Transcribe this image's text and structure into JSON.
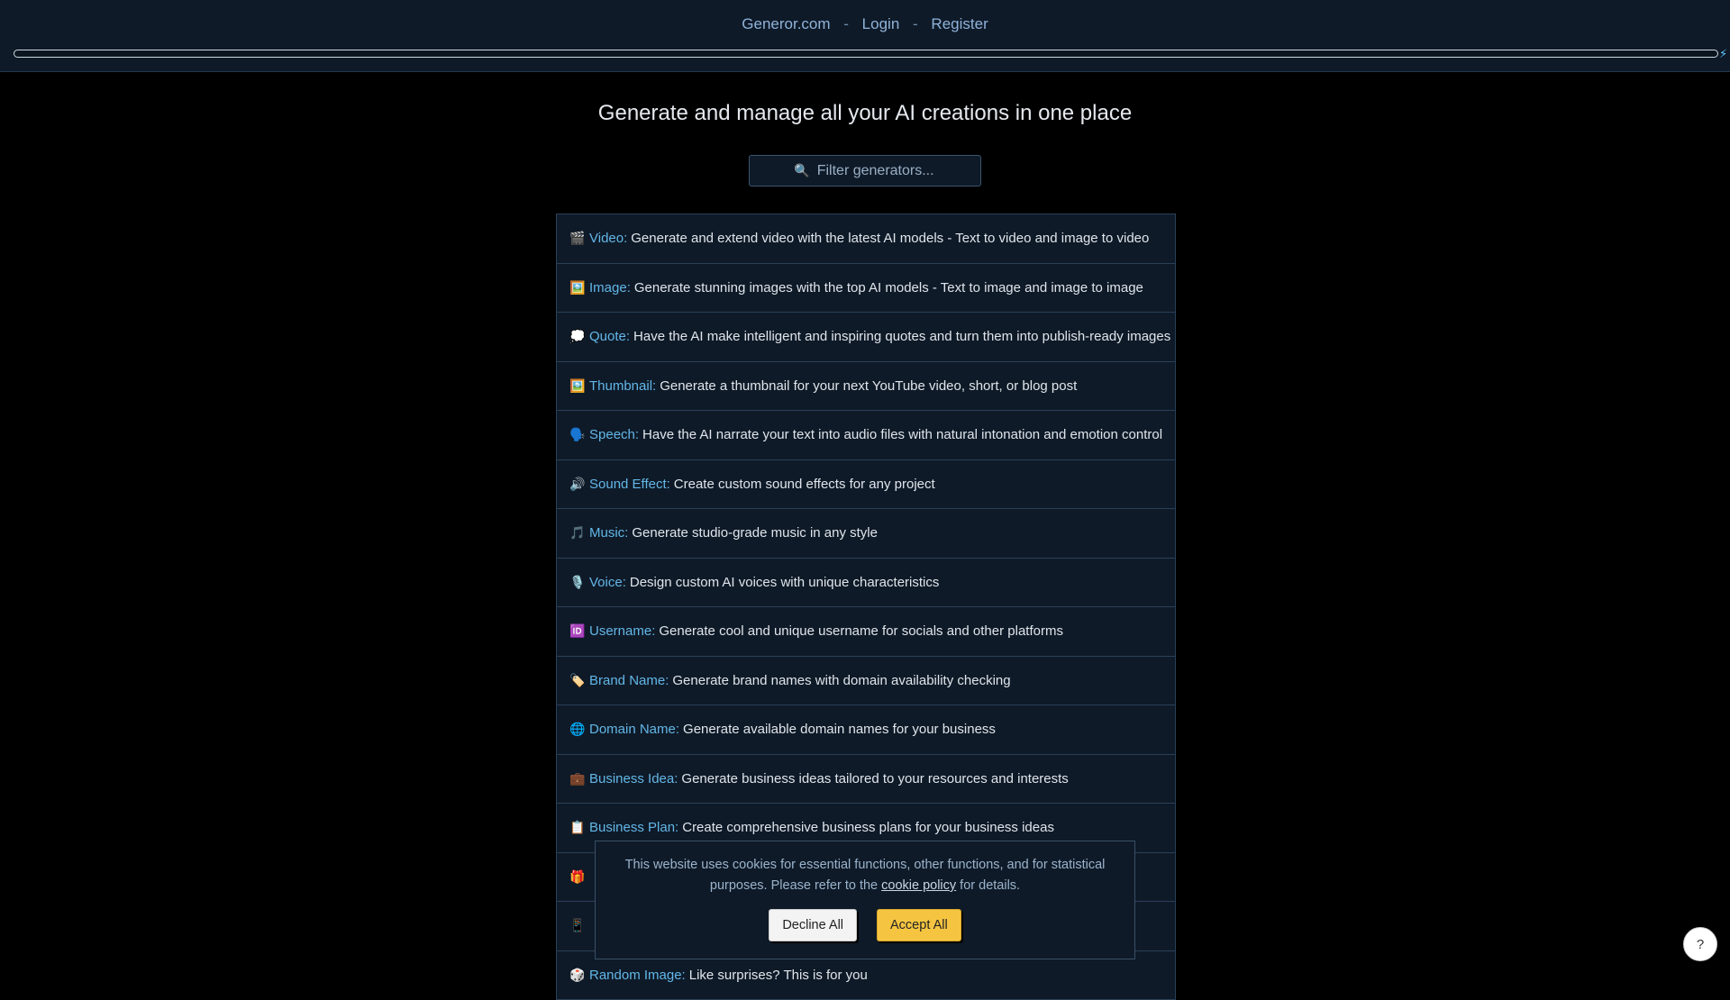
{
  "nav": {
    "site": "Generor.com",
    "sep1": "-",
    "login": "Login",
    "sep2": "-",
    "register": "Register"
  },
  "progress": {
    "fraction": 0.0
  },
  "headline": "Generate and manage all your AI creations in one place",
  "search": {
    "icon": "🔍",
    "placeholder": "Filter generators..."
  },
  "generators": [
    {
      "icon": "🎬",
      "name": "Video:",
      "desc": "Generate and extend video with the latest AI models - Text to video and image to video"
    },
    {
      "icon": "🖼️",
      "name": "Image:",
      "desc": "Generate stunning images with the top AI models - Text to image and image to image"
    },
    {
      "icon": "💭",
      "name": "Quote:",
      "desc": "Have the AI make intelligent and inspiring quotes and turn them into publish-ready images"
    },
    {
      "icon": "🖼️",
      "name": "Thumbnail:",
      "desc": "Generate a thumbnail for your next YouTube video, short, or blog post"
    },
    {
      "icon": "🗣️",
      "name": "Speech:",
      "desc": "Have the AI narrate your text into audio files with natural intonation and emotion control"
    },
    {
      "icon": "🔊",
      "name": "Sound Effect:",
      "desc": "Create custom sound effects for any project"
    },
    {
      "icon": "🎵",
      "name": "Music:",
      "desc": "Generate studio-grade music in any style"
    },
    {
      "icon": "🎙️",
      "name": "Voice:",
      "desc": "Design custom AI voices with unique characteristics"
    },
    {
      "icon": "🆔",
      "name": "Username:",
      "desc": "Generate cool and unique username for socials and other platforms"
    },
    {
      "icon": "🏷️",
      "name": "Brand Name:",
      "desc": "Generate brand names with domain availability checking"
    },
    {
      "icon": "🌐",
      "name": "Domain Name:",
      "desc": "Generate available domain names for your business"
    },
    {
      "icon": "💼",
      "name": "Business Idea:",
      "desc": "Generate business ideas tailored to your resources and interests"
    },
    {
      "icon": "📋",
      "name": "Business Plan:",
      "desc": "Create comprehensive business plans for your business ideas"
    },
    {
      "icon": "🎁",
      "name": "",
      "desc": ""
    },
    {
      "icon": "📱",
      "name": "",
      "desc": ""
    },
    {
      "icon": "🎲",
      "name": "Random Image:",
      "desc": "Like surprises? This is for you"
    }
  ],
  "cookie": {
    "text_before": "This website uses cookies for essential functions, other functions, and for statistical purposes. Please refer to the ",
    "policy_link": "cookie policy",
    "text_after": " for details.",
    "decline": "Decline All",
    "accept": "Accept All"
  },
  "help": "?",
  "icons": {
    "bolt": "⚡"
  },
  "colors": {
    "link": "#62b7e8",
    "accept": "#f5c542",
    "panel": "#0f1a28"
  }
}
